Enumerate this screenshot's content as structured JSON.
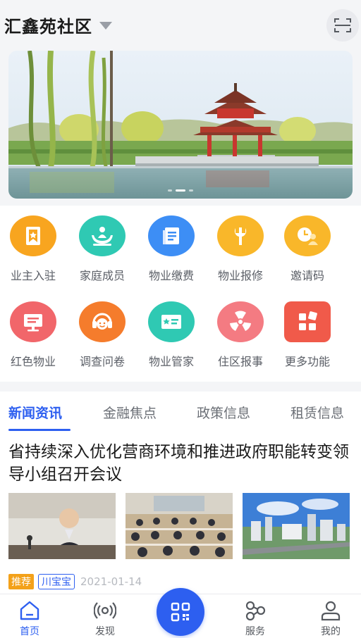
{
  "header": {
    "community_name": "汇鑫苑社区"
  },
  "banner": {
    "slide_count": 3,
    "active_slide": 2
  },
  "services": [
    {
      "label": "业主入驻",
      "icon": "owner-badge-icon",
      "color": "#f8a51f"
    },
    {
      "label": "家庭成员",
      "icon": "family-hands-icon",
      "color": "#2fc9b3"
    },
    {
      "label": "物业缴费",
      "icon": "bill-document-icon",
      "color": "#3d8ef5"
    },
    {
      "label": "物业报修",
      "icon": "wrench-icon",
      "color": "#f9b72a"
    },
    {
      "label": "邀请码",
      "icon": "invite-clock-user-icon",
      "color": "#f9b72a"
    },
    {
      "label": "红色物业",
      "icon": "monitor-icon",
      "color": "#f1666a"
    },
    {
      "label": "调查问卷",
      "icon": "headset-smile-icon",
      "color": "#f57c2c"
    },
    {
      "label": "物业管家",
      "icon": "butler-card-icon",
      "color": "#2fc9b3"
    },
    {
      "label": "住区报事",
      "icon": "radiation-icon",
      "color": "#f47b82"
    },
    {
      "label": "更多功能",
      "icon": "more-grid-icon",
      "color": "#f05a4a"
    }
  ],
  "news": {
    "tabs": [
      "新闻资讯",
      "金融焦点",
      "政策信息",
      "租赁信息"
    ],
    "active_tab": 0,
    "article": {
      "title": "省持续深入优化营商环境和推进政府职能转变领导小组召开会议",
      "tag": "推荐",
      "source": "川宝宝",
      "date": "2021-01-14"
    }
  },
  "bottom_nav": {
    "items": [
      {
        "label": "首页",
        "icon": "home-icon"
      },
      {
        "label": "发现",
        "icon": "discover-signal-icon"
      },
      {
        "label": "服务",
        "icon": "service-nodes-icon"
      },
      {
        "label": "我的",
        "icon": "profile-icon"
      }
    ],
    "center_icon": "qr-scan-icon",
    "active": 0
  },
  "colors": {
    "accent": "#2d5ff0",
    "badge_recommend": "#f3a11a"
  }
}
